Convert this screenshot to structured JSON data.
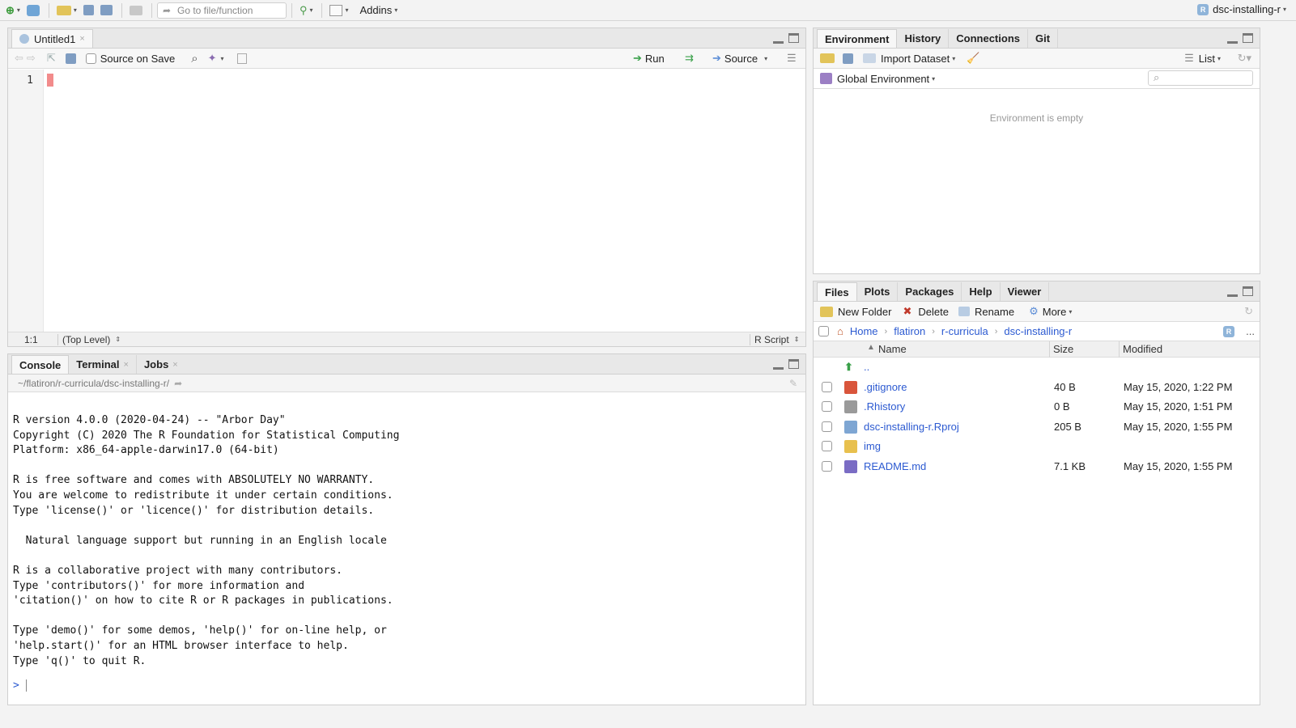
{
  "topbar": {
    "goto_placeholder": "Go to file/function",
    "addins_label": "Addins",
    "project_name": "dsc-installing-r"
  },
  "source_pane": {
    "tab_label": "Untitled1",
    "source_on_save": "Source on Save",
    "run_label": "Run",
    "source_label": "Source",
    "line_number": "1",
    "cursor_pos": "1:1",
    "scope": "(Top Level)",
    "file_type": "R Script"
  },
  "console_pane": {
    "tabs": [
      "Console",
      "Terminal",
      "Jobs"
    ],
    "path": "~/flatiron/r-curricula/dsc-installing-r/",
    "lines": [
      "R version 4.0.0 (2020-04-24) -- \"Arbor Day\"",
      "Copyright (C) 2020 The R Foundation for Statistical Computing",
      "Platform: x86_64-apple-darwin17.0 (64-bit)",
      "",
      "R is free software and comes with ABSOLUTELY NO WARRANTY.",
      "You are welcome to redistribute it under certain conditions.",
      "Type 'license()' or 'licence()' for distribution details.",
      "",
      "  Natural language support but running in an English locale",
      "",
      "R is a collaborative project with many contributors.",
      "Type 'contributors()' for more information and",
      "'citation()' on how to cite R or R packages in publications.",
      "",
      "Type 'demo()' for some demos, 'help()' for on-line help, or",
      "'help.start()' for an HTML browser interface to help.",
      "Type 'q()' to quit R."
    ],
    "prompt": ">"
  },
  "env_pane": {
    "tabs": [
      "Environment",
      "History",
      "Connections",
      "Git"
    ],
    "import_label": "Import Dataset",
    "list_label": "List",
    "global_env": "Global Environment",
    "empty_msg": "Environment is empty"
  },
  "files_pane": {
    "tabs": [
      "Files",
      "Plots",
      "Packages",
      "Help",
      "Viewer"
    ],
    "new_folder": "New Folder",
    "delete": "Delete",
    "rename": "Rename",
    "more": "More",
    "crumbs": [
      "Home",
      "flatiron",
      "r-curricula",
      "dsc-installing-r"
    ],
    "more_dots": "...",
    "headers": {
      "name": "Name",
      "size": "Size",
      "modified": "Modified"
    },
    "parent": "..",
    "files": [
      {
        "name": ".gitignore",
        "size": "40 B",
        "modified": "May 15, 2020, 1:22 PM",
        "icon": "gitignore-icon",
        "color": "#d9553b"
      },
      {
        "name": ".Rhistory",
        "size": "0 B",
        "modified": "May 15, 2020, 1:51 PM",
        "icon": "history-file-icon",
        "color": "#9a9a9a"
      },
      {
        "name": "dsc-installing-r.Rproj",
        "size": "205 B",
        "modified": "May 15, 2020, 1:55 PM",
        "icon": "rproj-icon",
        "color": "#7ea6d3"
      },
      {
        "name": "img",
        "size": "",
        "modified": "",
        "icon": "folder-icon",
        "color": "#e8c04e"
      },
      {
        "name": "README.md",
        "size": "7.1 KB",
        "modified": "May 15, 2020, 1:55 PM",
        "icon": "markdown-icon",
        "color": "#7a6cc4"
      }
    ]
  }
}
